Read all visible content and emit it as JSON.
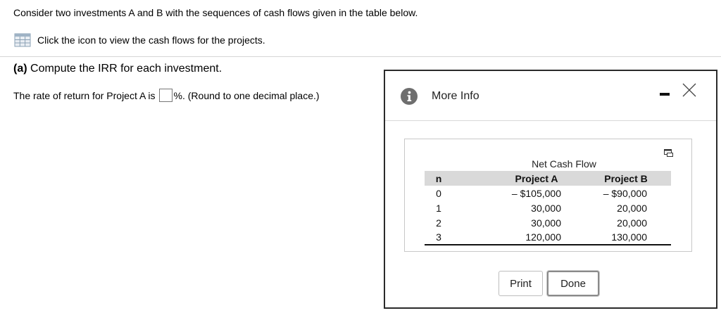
{
  "question": {
    "text": "Consider two investments A and B with the sequences of cash flows given in the table below.",
    "view_link": "Click the icon to view the cash flows for the projects."
  },
  "part": {
    "label": "(a)",
    "title": " Compute the IRR for each investment.",
    "prompt_prefix": "The rate of return for Project A is",
    "prompt_suffix": "%. (Round to one decimal place.)",
    "answer_value": ""
  },
  "modal": {
    "title": "More Info",
    "table_caption": "Net Cash Flow",
    "columns": [
      "n",
      "Project A",
      "Project B"
    ],
    "rows": [
      [
        "0",
        "– $105,000",
        "– $90,000"
      ],
      [
        "1",
        "30,000",
        "20,000"
      ],
      [
        "2",
        "30,000",
        "20,000"
      ],
      [
        "3",
        "120,000",
        "130,000"
      ]
    ],
    "print_label": "Print",
    "done_label": "Done"
  },
  "icons": {
    "table": "table-icon",
    "info": "info-icon",
    "minimize": "minimize-icon",
    "close": "close-icon",
    "copy": "copy-icon"
  }
}
